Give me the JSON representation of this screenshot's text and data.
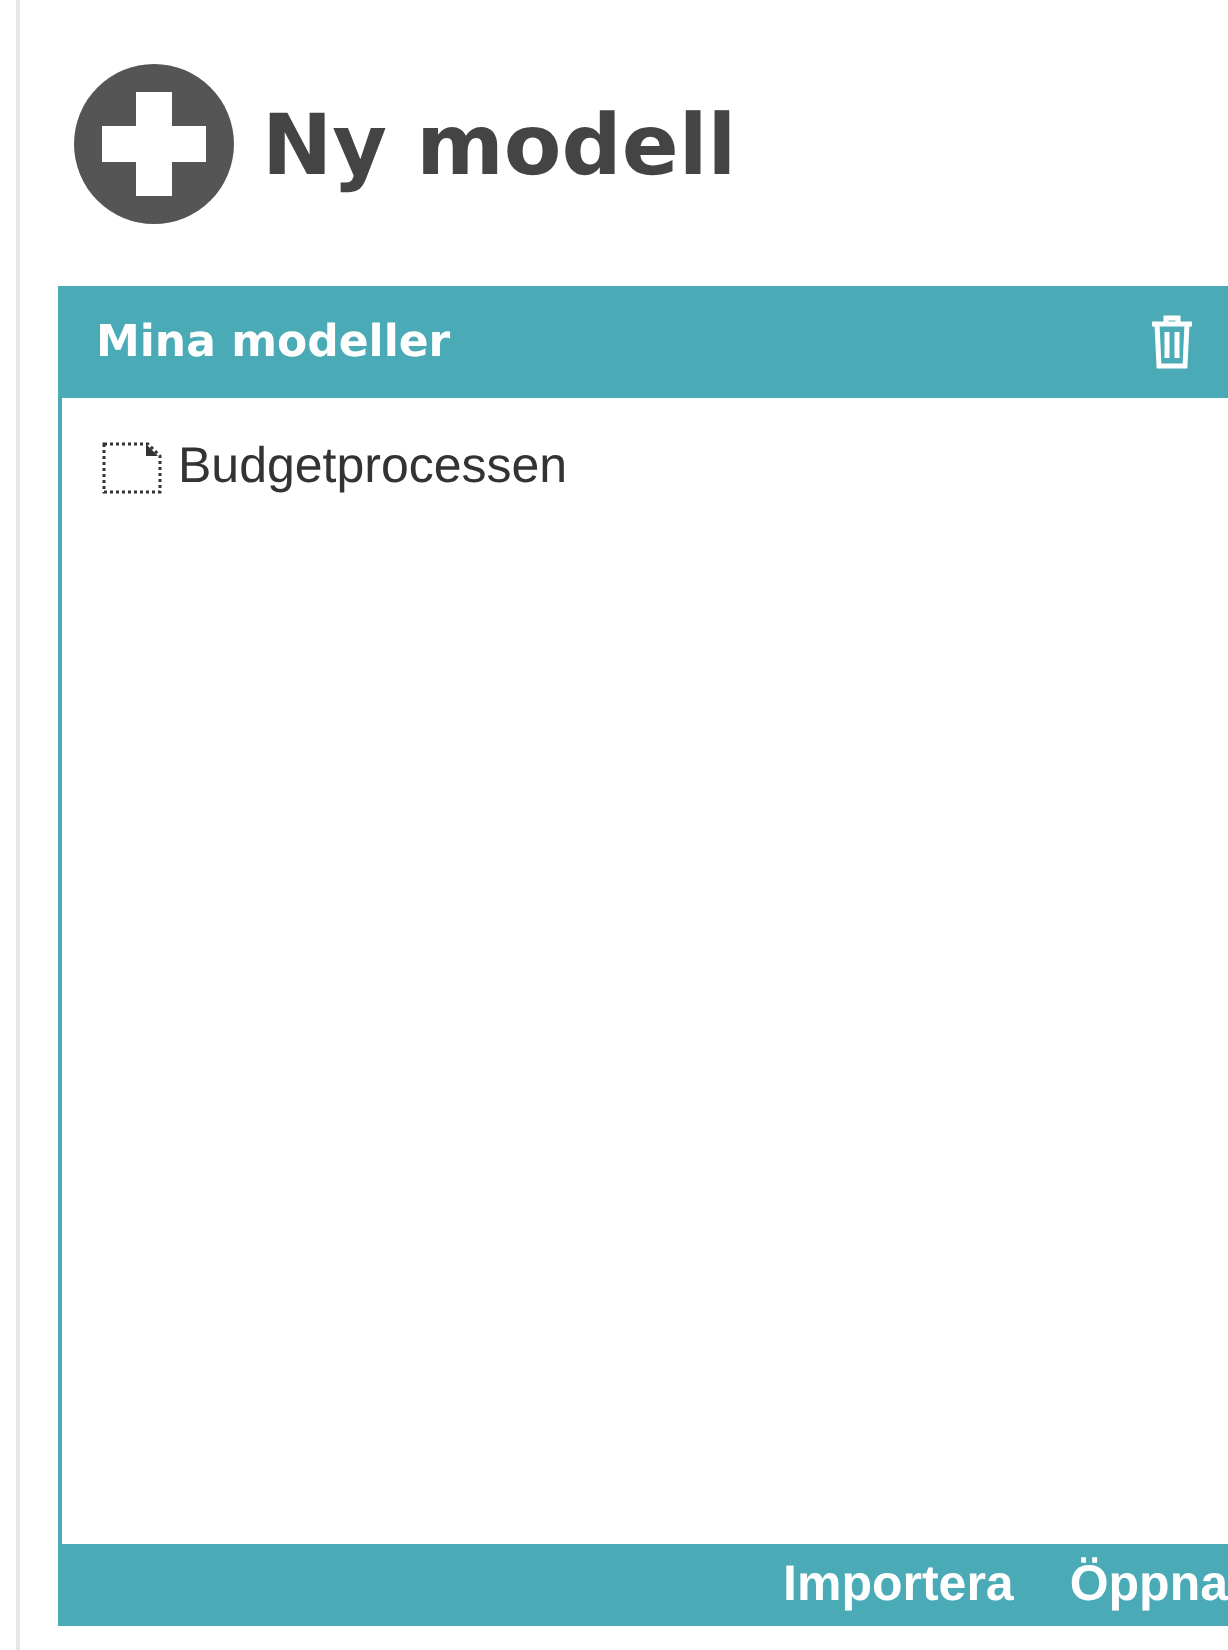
{
  "new_model": {
    "label": "Ny modell"
  },
  "panel": {
    "title": "Mina modeller",
    "items": [
      {
        "name": "Budgetprocessen"
      }
    ],
    "footer_buttons": [
      "Importera",
      "Öppna"
    ]
  }
}
